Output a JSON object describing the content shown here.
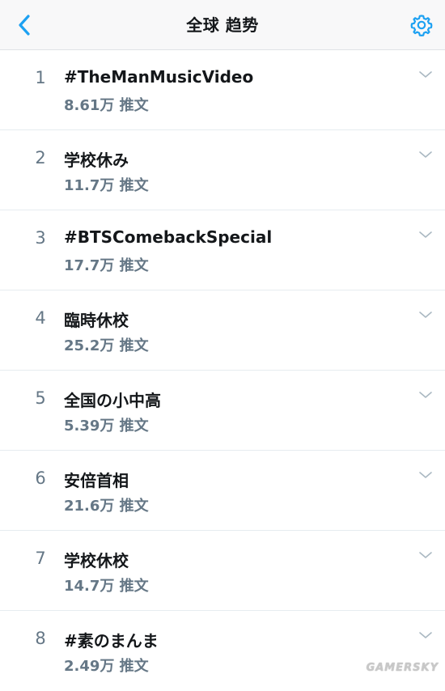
{
  "header": {
    "title": "全球 趋势",
    "back_icon": "chevron-left-icon",
    "settings_icon": "gear-icon",
    "accent_color": "#1da1f2"
  },
  "trends": [
    {
      "rank": "1",
      "topic": "#TheManMusicVideo",
      "count": "8.61万 推文"
    },
    {
      "rank": "2",
      "topic": "学校休み",
      "count": "11.7万 推文"
    },
    {
      "rank": "3",
      "topic": "#BTSComebackSpecial",
      "count": "17.7万 推文"
    },
    {
      "rank": "4",
      "topic": "臨時休校",
      "count": "25.2万 推文"
    },
    {
      "rank": "5",
      "topic": "全国の小中高",
      "count": "5.39万 推文"
    },
    {
      "rank": "6",
      "topic": "安倍首相",
      "count": "21.6万 推文"
    },
    {
      "rank": "7",
      "topic": "学校休校",
      "count": "14.7万 推文"
    },
    {
      "rank": "8",
      "topic": "#素のまんま",
      "count": "2.49万 推文"
    }
  ],
  "watermark": "GAMERSKY"
}
